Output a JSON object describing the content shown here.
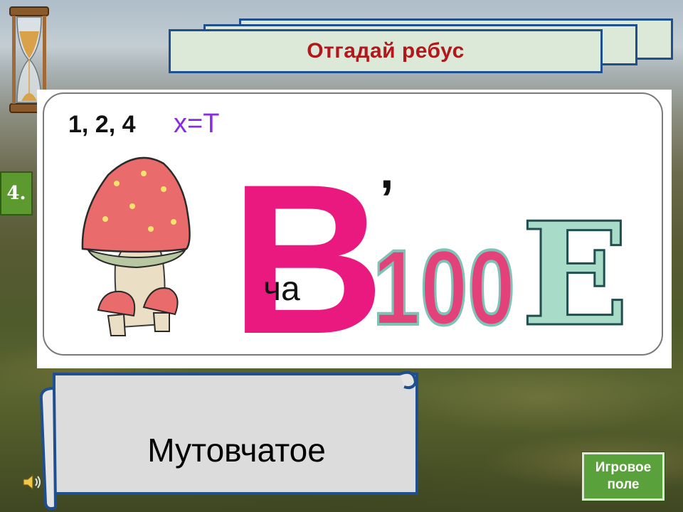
{
  "slide": {
    "title": "Отгадай ребус",
    "question_number": "4."
  },
  "rebus": {
    "hint_numbers": "1, 2, 4",
    "hint_replace": "x=T",
    "big_letter": "B",
    "inner_letters": "ча",
    "comma": ",",
    "number": "100",
    "letter_e": "E"
  },
  "answer": {
    "text": "Мутовчатое"
  },
  "controls": {
    "game_field_label": "Игровое\nполе"
  },
  "colors": {
    "title_text": "#b1181b",
    "banner_fill": "#dde9d8",
    "banner_border": "#1f4f8f",
    "badge_green": "#5c9a2f",
    "button_green": "#59a13a",
    "rebus_pink": "#e9197f",
    "rebus_purple": "#8b2be0"
  },
  "icons": [
    "hourglass-icon",
    "speaker-icon",
    "mushroom-icon"
  ]
}
